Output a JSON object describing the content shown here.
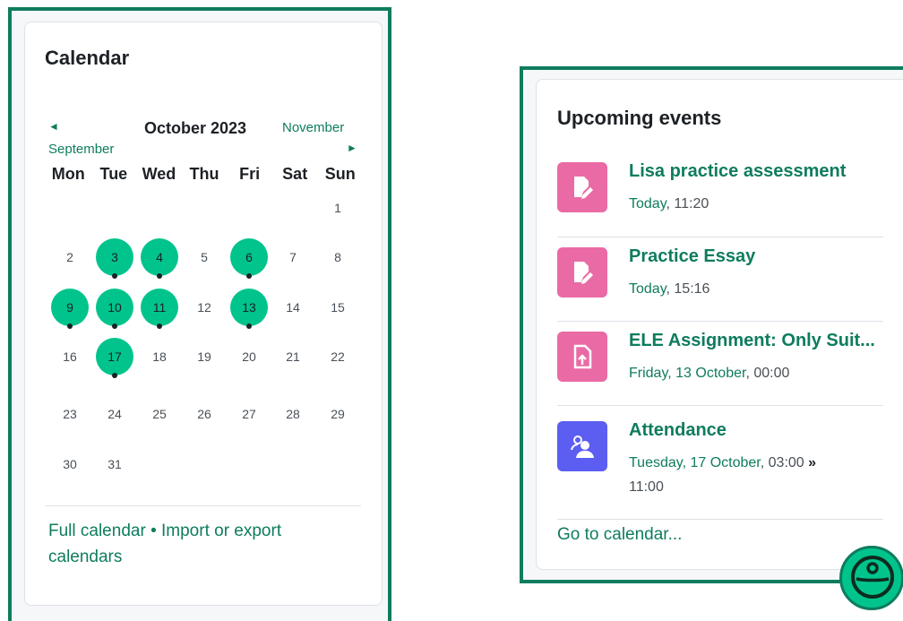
{
  "calendar": {
    "title": "Calendar",
    "prev_month": "September",
    "month_title": "October 2023",
    "next_month": "November",
    "weekdays": [
      "Mon",
      "Tue",
      "Wed",
      "Thu",
      "Fri",
      "Sat",
      "Sun"
    ],
    "days": [
      "1",
      "2",
      "3",
      "4",
      "5",
      "6",
      "7",
      "8",
      "9",
      "10",
      "11",
      "12",
      "13",
      "14",
      "15",
      "16",
      "17",
      "18",
      "19",
      "20",
      "21",
      "22",
      "23",
      "24",
      "25",
      "26",
      "27",
      "28",
      "29",
      "30",
      "31"
    ],
    "event_days": [
      "3",
      "4",
      "6",
      "9",
      "10",
      "11",
      "13",
      "17"
    ],
    "footer": {
      "full_calendar": "Full calendar",
      "separator": "•",
      "import_export": "Import or export calendars"
    },
    "colors": {
      "accent": "#0e7c5e",
      "event_day": "#00c48c"
    }
  },
  "upcoming": {
    "title": "Upcoming events",
    "events": [
      {
        "name": "Lisa practice assessment",
        "date": "Today",
        "time": ", 11:20",
        "end": "",
        "end_time": "",
        "icon": "assignment-edit-icon",
        "color": "#ea6aa5"
      },
      {
        "name": "Practice Essay",
        "date": "Today",
        "time": ", 15:16",
        "end": "",
        "end_time": "",
        "icon": "assignment-edit-icon",
        "color": "#ea6aa5"
      },
      {
        "name": "ELE Assignment: Only Suit...",
        "date": "Friday, 13 October",
        "time": ", 00:00",
        "end": "",
        "end_time": "",
        "icon": "file-upload-icon",
        "color": "#ea6aa5"
      },
      {
        "name": "Attendance",
        "date": "Tuesday, 17 October",
        "time": ", 03:00",
        "end": "»",
        "end_time": "11:00",
        "icon": "attendance-people-icon",
        "color": "#5b5ef0"
      }
    ],
    "goto": "Go to calendar..."
  }
}
